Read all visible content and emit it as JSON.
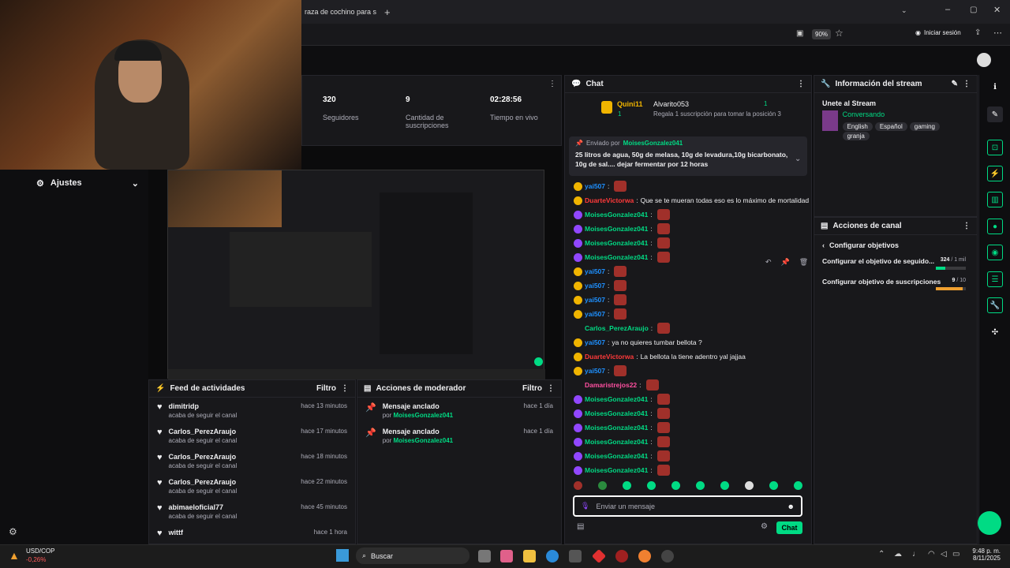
{
  "browser": {
    "tab_title": "raza de cochino para s",
    "zoom": "90%",
    "signin": "Iniciar sesión"
  },
  "sidebar": {
    "settings_label": "Ajustes"
  },
  "stats": [
    {
      "value": "320",
      "label": "Seguidores"
    },
    {
      "value": "9",
      "label": "Cantidad de suscripciones"
    },
    {
      "value": "02:28:56",
      "label": "Tiempo en vivo"
    }
  ],
  "feed": {
    "title": "Feed de actividades",
    "filter": "Filtro",
    "items": [
      {
        "name": "dimitridp",
        "action": "acaba de seguir el canal",
        "time": "hace 13 minutos"
      },
      {
        "name": "Carlos_PerezAraujo",
        "action": "acaba de seguir el canal",
        "time": "hace 17 minutos"
      },
      {
        "name": "Carlos_PerezAraujo",
        "action": "acaba de seguir el canal",
        "time": "hace 18 minutos"
      },
      {
        "name": "Carlos_PerezAraujo",
        "action": "acaba de seguir el canal",
        "time": "hace 22 minutos"
      },
      {
        "name": "abimaeloficial77",
        "action": "acaba de seguir el canal",
        "time": "hace 45 minutos"
      },
      {
        "name": "wittf",
        "action": "",
        "time": "hace 1 hora"
      }
    ]
  },
  "modactions": {
    "title": "Acciones de moderador",
    "filter": "Filtro",
    "items": [
      {
        "action": "Mensaje anclado",
        "by": "por",
        "user": "MoisesGonzalez041",
        "time": "hace 1 día"
      },
      {
        "action": "Mensaje anclado",
        "by": "por",
        "user": "MoisesGonzalez041",
        "time": "hace 1 día"
      }
    ]
  },
  "chat": {
    "title": "Chat",
    "top_user": "Quini11",
    "top_count": "1",
    "second_user": "Alvarito053",
    "second_count": "1",
    "gift_text": "Regala 1 suscripción para tomar la posición 3",
    "pinned_by_label": "Enviado por",
    "pinned_by": "MoisesGonzalez041",
    "pinned_text": "25 litros de agua, 50g de melasa, 10g de levadura,10g bicarbonato, 10g de sal.... dejar fermentar por 12 horas",
    "messages": [
      {
        "user": "yai507",
        "text": "",
        "color": "#1e90ff"
      },
      {
        "user": "DuarteVictorwa",
        "text": "Que se te mueran todas eso es lo máximo de mortalidad",
        "color": "#ff3a3a"
      },
      {
        "user": "MoisesGonzalez041",
        "text": "",
        "color": "#00db84"
      },
      {
        "user": "MoisesGonzalez041",
        "text": "",
        "color": "#00db84"
      },
      {
        "user": "MoisesGonzalez041",
        "text": "",
        "color": "#00db84"
      },
      {
        "user": "MoisesGonzalez041",
        "text": "",
        "color": "#00db84"
      },
      {
        "user": "yai507",
        "text": "",
        "color": "#1e90ff"
      },
      {
        "user": "yai507",
        "text": "",
        "color": "#1e90ff"
      },
      {
        "user": "yai507",
        "text": "",
        "color": "#1e90ff"
      },
      {
        "user": "yai507",
        "text": "",
        "color": "#1e90ff"
      },
      {
        "user": "Carlos_PerezAraujo",
        "text": "",
        "color": "#00db84"
      },
      {
        "user": "yai507",
        "text": "ya no quieres tumbar bellota ?",
        "color": "#1e90ff"
      },
      {
        "user": "DuarteVictorwa",
        "text": "La bellota la tiene adentro yal jajjaa",
        "color": "#ff3a3a"
      },
      {
        "user": "yai507",
        "text": "",
        "color": "#1e90ff"
      },
      {
        "user": "Damaristrejos22",
        "text": "",
        "color": "#ff4fa0"
      },
      {
        "user": "MoisesGonzalez041",
        "text": "",
        "color": "#00db84"
      },
      {
        "user": "MoisesGonzalez041",
        "text": "",
        "color": "#00db84"
      },
      {
        "user": "MoisesGonzalez041",
        "text": "",
        "color": "#00db84"
      },
      {
        "user": "MoisesGonzalez041",
        "text": "",
        "color": "#00db84"
      },
      {
        "user": "MoisesGonzalez041",
        "text": "",
        "color": "#00db84"
      },
      {
        "user": "MoisesGonzalez041",
        "text": "",
        "color": "#00db84"
      }
    ],
    "input_placeholder": "Enviar un mensaje",
    "send_label": "Chat"
  },
  "info": {
    "title": "Información del stream",
    "stream_title": "Unete al Stream",
    "category": "Conversando",
    "tags": [
      "English",
      "Español",
      "gaming",
      "granja"
    ]
  },
  "acciones": {
    "title": "Acciones de canal",
    "sub": "Configurar objetivos",
    "goal1": "Configurar el objetivo de seguido...",
    "goal1_value": "324",
    "goal1_max": "/ 1 mil",
    "goal1_progress": 0.324,
    "goal2": "Configurar objetivo de suscripciones",
    "goal2_value": "9",
    "goal2_max": "/ 10",
    "goal2_progress": 0.9
  },
  "taskbar": {
    "ticker": "USD/COP",
    "ticker_change": "-0,26%",
    "search": "Buscar",
    "time": "9:48 p. m.",
    "date": "8/11/2025"
  }
}
